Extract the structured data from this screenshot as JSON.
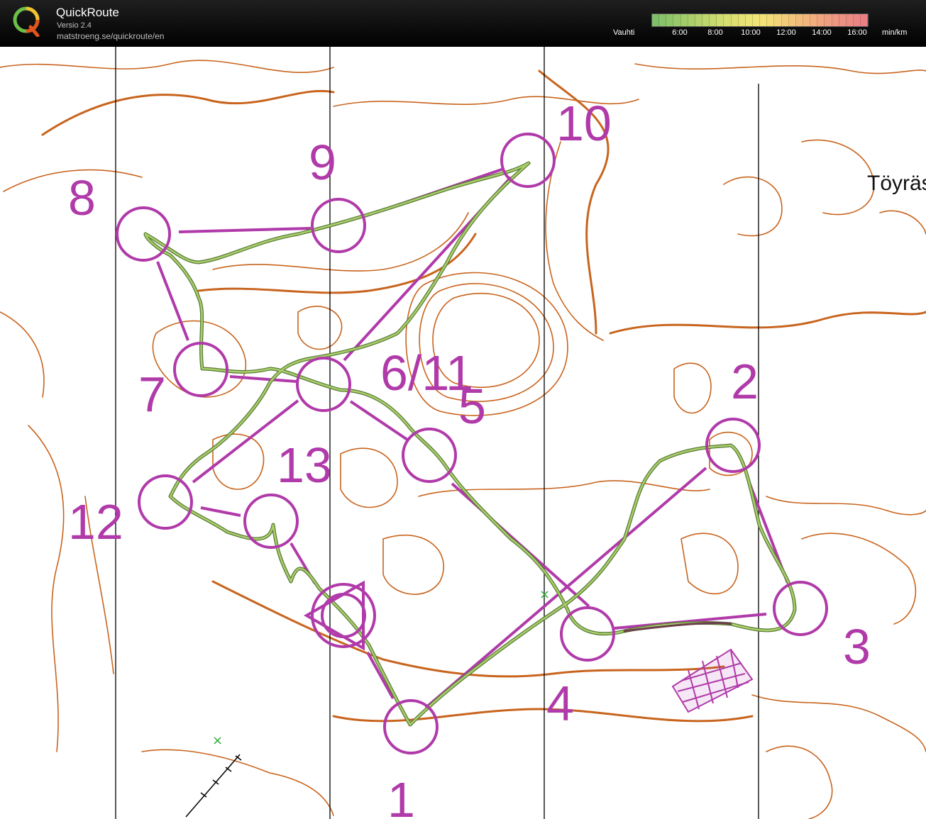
{
  "app": {
    "name": "QuickRoute",
    "version": "Versio 2.4",
    "url": "matstroeng.se/quickroute/en"
  },
  "pace_scale": {
    "label": "Vauhti",
    "unit": "min/km",
    "ticks": [
      "6:00",
      "8:00",
      "10:00",
      "12:00",
      "14:00",
      "16:00"
    ],
    "gradient_colors": [
      "#7fbf6a",
      "#a9cf6a",
      "#d6df70",
      "#f2e677",
      "#f3c27a",
      "#ef9c80",
      "#ea7f84"
    ]
  },
  "map": {
    "place_name": "Töyräs",
    "colors": {
      "contour": "#c8641e",
      "course": "#b03aa9",
      "route": "#7fa85a",
      "grid_line": "#000000"
    },
    "controls": [
      {
        "label": "1"
      },
      {
        "label": "2"
      },
      {
        "label": "3"
      },
      {
        "label": "4"
      },
      {
        "label": "5"
      },
      {
        "label": "6/11"
      },
      {
        "label": "7"
      },
      {
        "label": "8"
      },
      {
        "label": "9"
      },
      {
        "label": "10"
      },
      {
        "label": "12"
      },
      {
        "label": "13"
      }
    ]
  }
}
